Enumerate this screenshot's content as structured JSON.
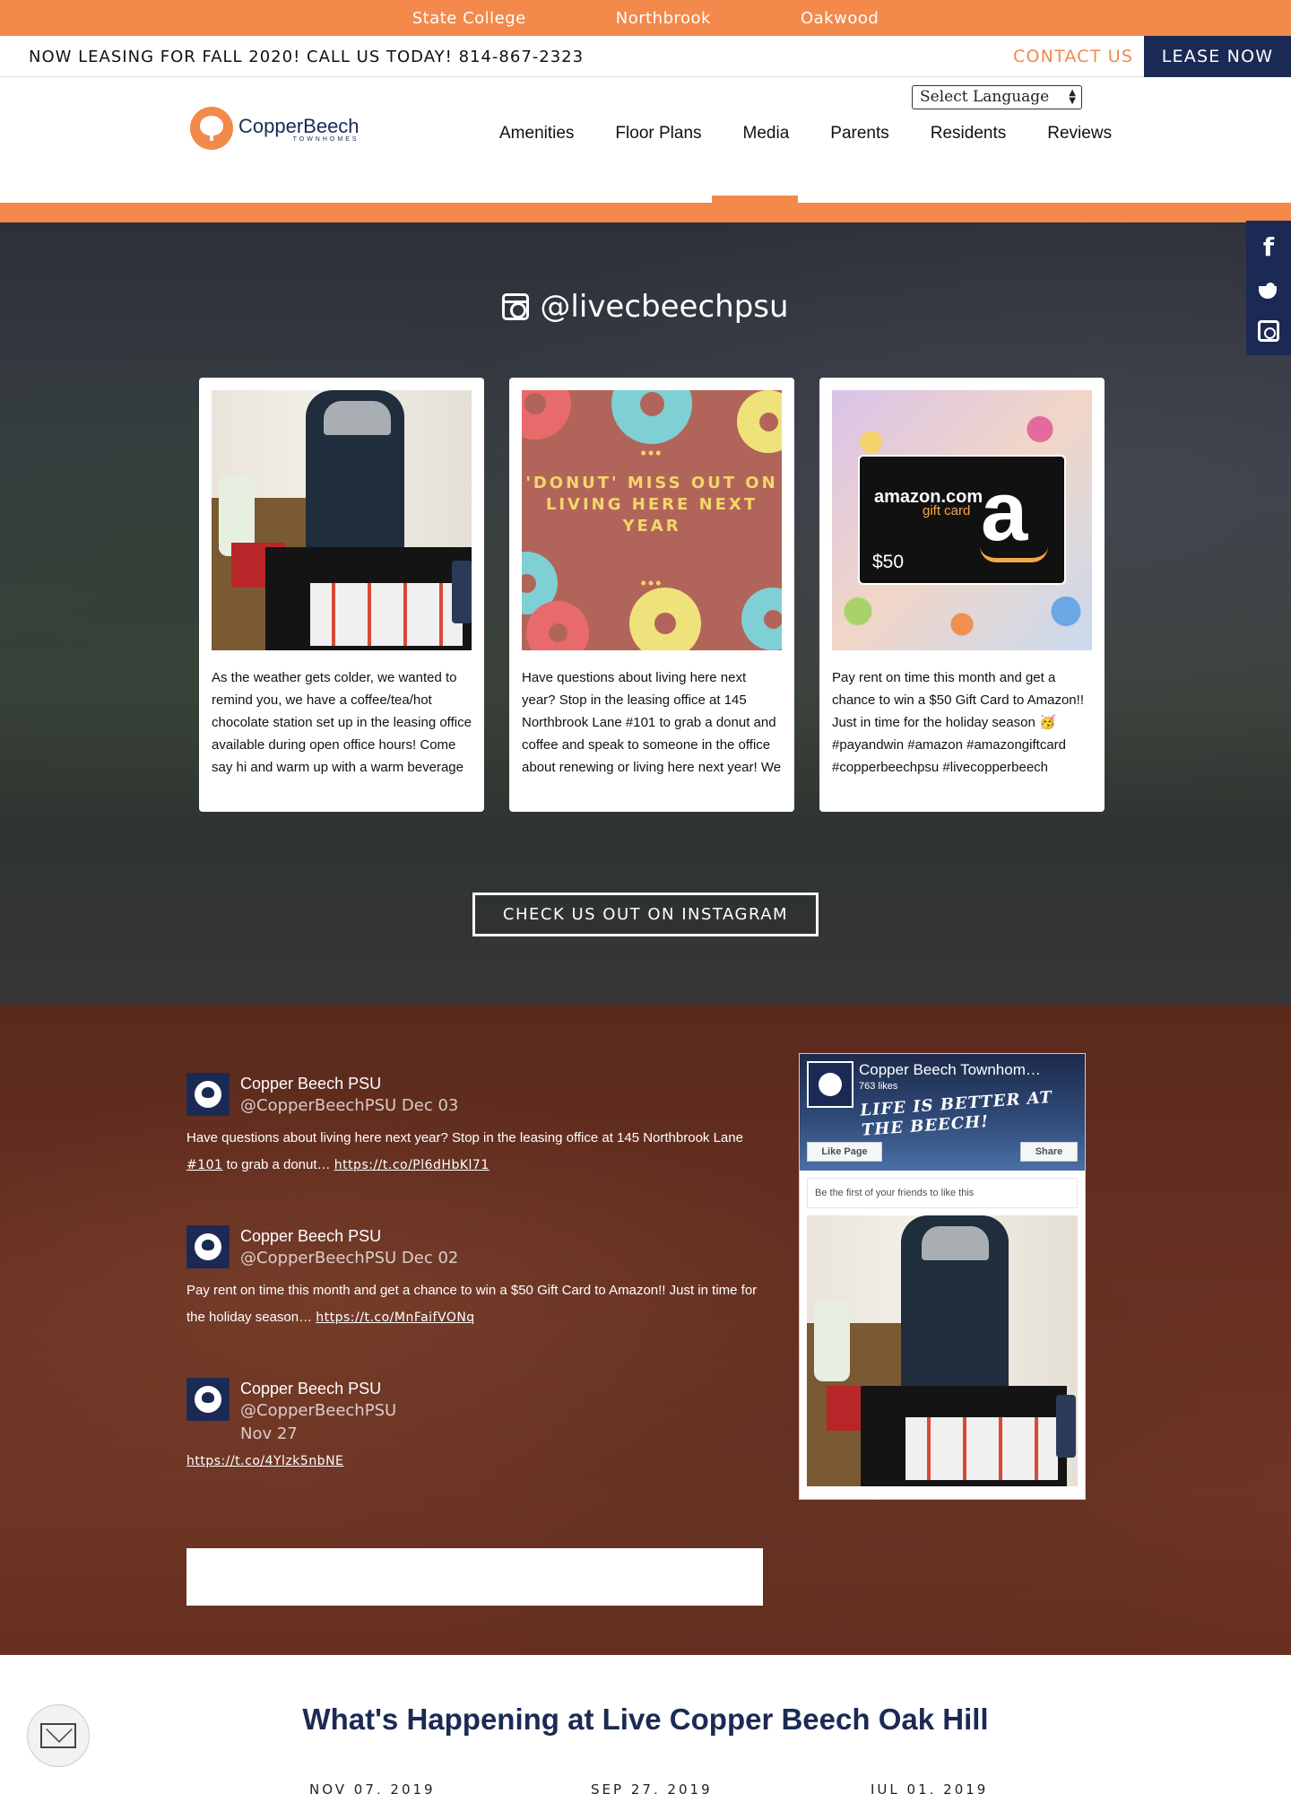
{
  "locations": [
    "State College",
    "Northbrook",
    "Oakwood"
  ],
  "lease_bar": {
    "message": "NOW LEASING FOR FALL 2020! CALL US TODAY! 814-867-2323",
    "contact_label": "CONTACT US",
    "lease_label": "LEASE NOW"
  },
  "header": {
    "language_select": "Select Language",
    "logo_name": "CopperBeech",
    "logo_sub": "TOWNHOMES",
    "nav": [
      "Amenities",
      "Floor Plans",
      "Media",
      "Parents",
      "Residents",
      "Reviews"
    ],
    "active_nav": "Media"
  },
  "instagram": {
    "handle": "@livecbeechpsu",
    "cards": [
      {
        "text": "As the weather gets colder, we wanted to remind you, we have a coffee/tea/hot chocolate station set up in the leasing office available during open office hours! Come say hi and warm up with a warm beverage ❄️☕😊 #st..."
      },
      {
        "text": "Have questions about living here next year? Stop in the leasing office at 145 Northbrook Lane #101 to grab a donut and coffee and speak to someone in the office about renewing or living here next year! We would love to hear from you..."
      },
      {
        "text": "Pay rent on time this month and get a chance to win a $50 Gift Card to Amazon!! Just in time for the holiday season 🥳 #payandwin #amazon #amazongiftcard #copperbeechpsu #livecopperbeech #studentliving"
      }
    ],
    "donut_image_text": "'DONUT' MISS OUT ON LIVING HERE NEXT YEAR",
    "donut_dots": "•••",
    "amazon_brand": "amazon.com",
    "amazon_sub": "gift card",
    "amazon_letter": "a",
    "amazon_price": "$50",
    "button_label": "CHECK US OUT ON INSTAGRAM"
  },
  "social_sidebar": {
    "facebook_glyph": "f"
  },
  "tweets": [
    {
      "name": "Copper Beech PSU",
      "handle": "@CopperBeechPSU Dec 03",
      "text_before": "Have questions about living here next year? Stop in the leasing office at 145 Northbrook Lane ",
      "hashtag": "#101",
      "text_after": " to grab a donut… ",
      "link": "https://t.co/Pl6dHbKl71"
    },
    {
      "name": "Copper Beech PSU",
      "handle": "@CopperBeechPSU Dec 02",
      "text_before": "Pay rent on time this month and get a chance to win a $50 Gift Card to Amazon!! Just in time for the holiday season… ",
      "link": "https://t.co/MnFaifVONq"
    },
    {
      "name": "Copper Beech PSU",
      "handle": "@CopperBeechPSU",
      "date": "Nov 27",
      "link": "https://t.co/4Ylzk5nbNE"
    }
  ],
  "facebook": {
    "page_title": "Copper Beech Townhom…",
    "likes": "763 likes",
    "cover_text": "LIFE IS BETTER AT THE BEECH!",
    "like_label": "Like Page",
    "share_label": "Share",
    "friends_text": "Be the first of your friends to like this"
  },
  "happening": {
    "title": "What's Happening at Live Copper Beech Oak Hill",
    "dates": [
      "NOV 07, 2019",
      "SEP 27, 2019",
      "JUL 01, 2019"
    ]
  },
  "colors": {
    "accent": "#f3894a",
    "navy": "#1b2a55"
  }
}
